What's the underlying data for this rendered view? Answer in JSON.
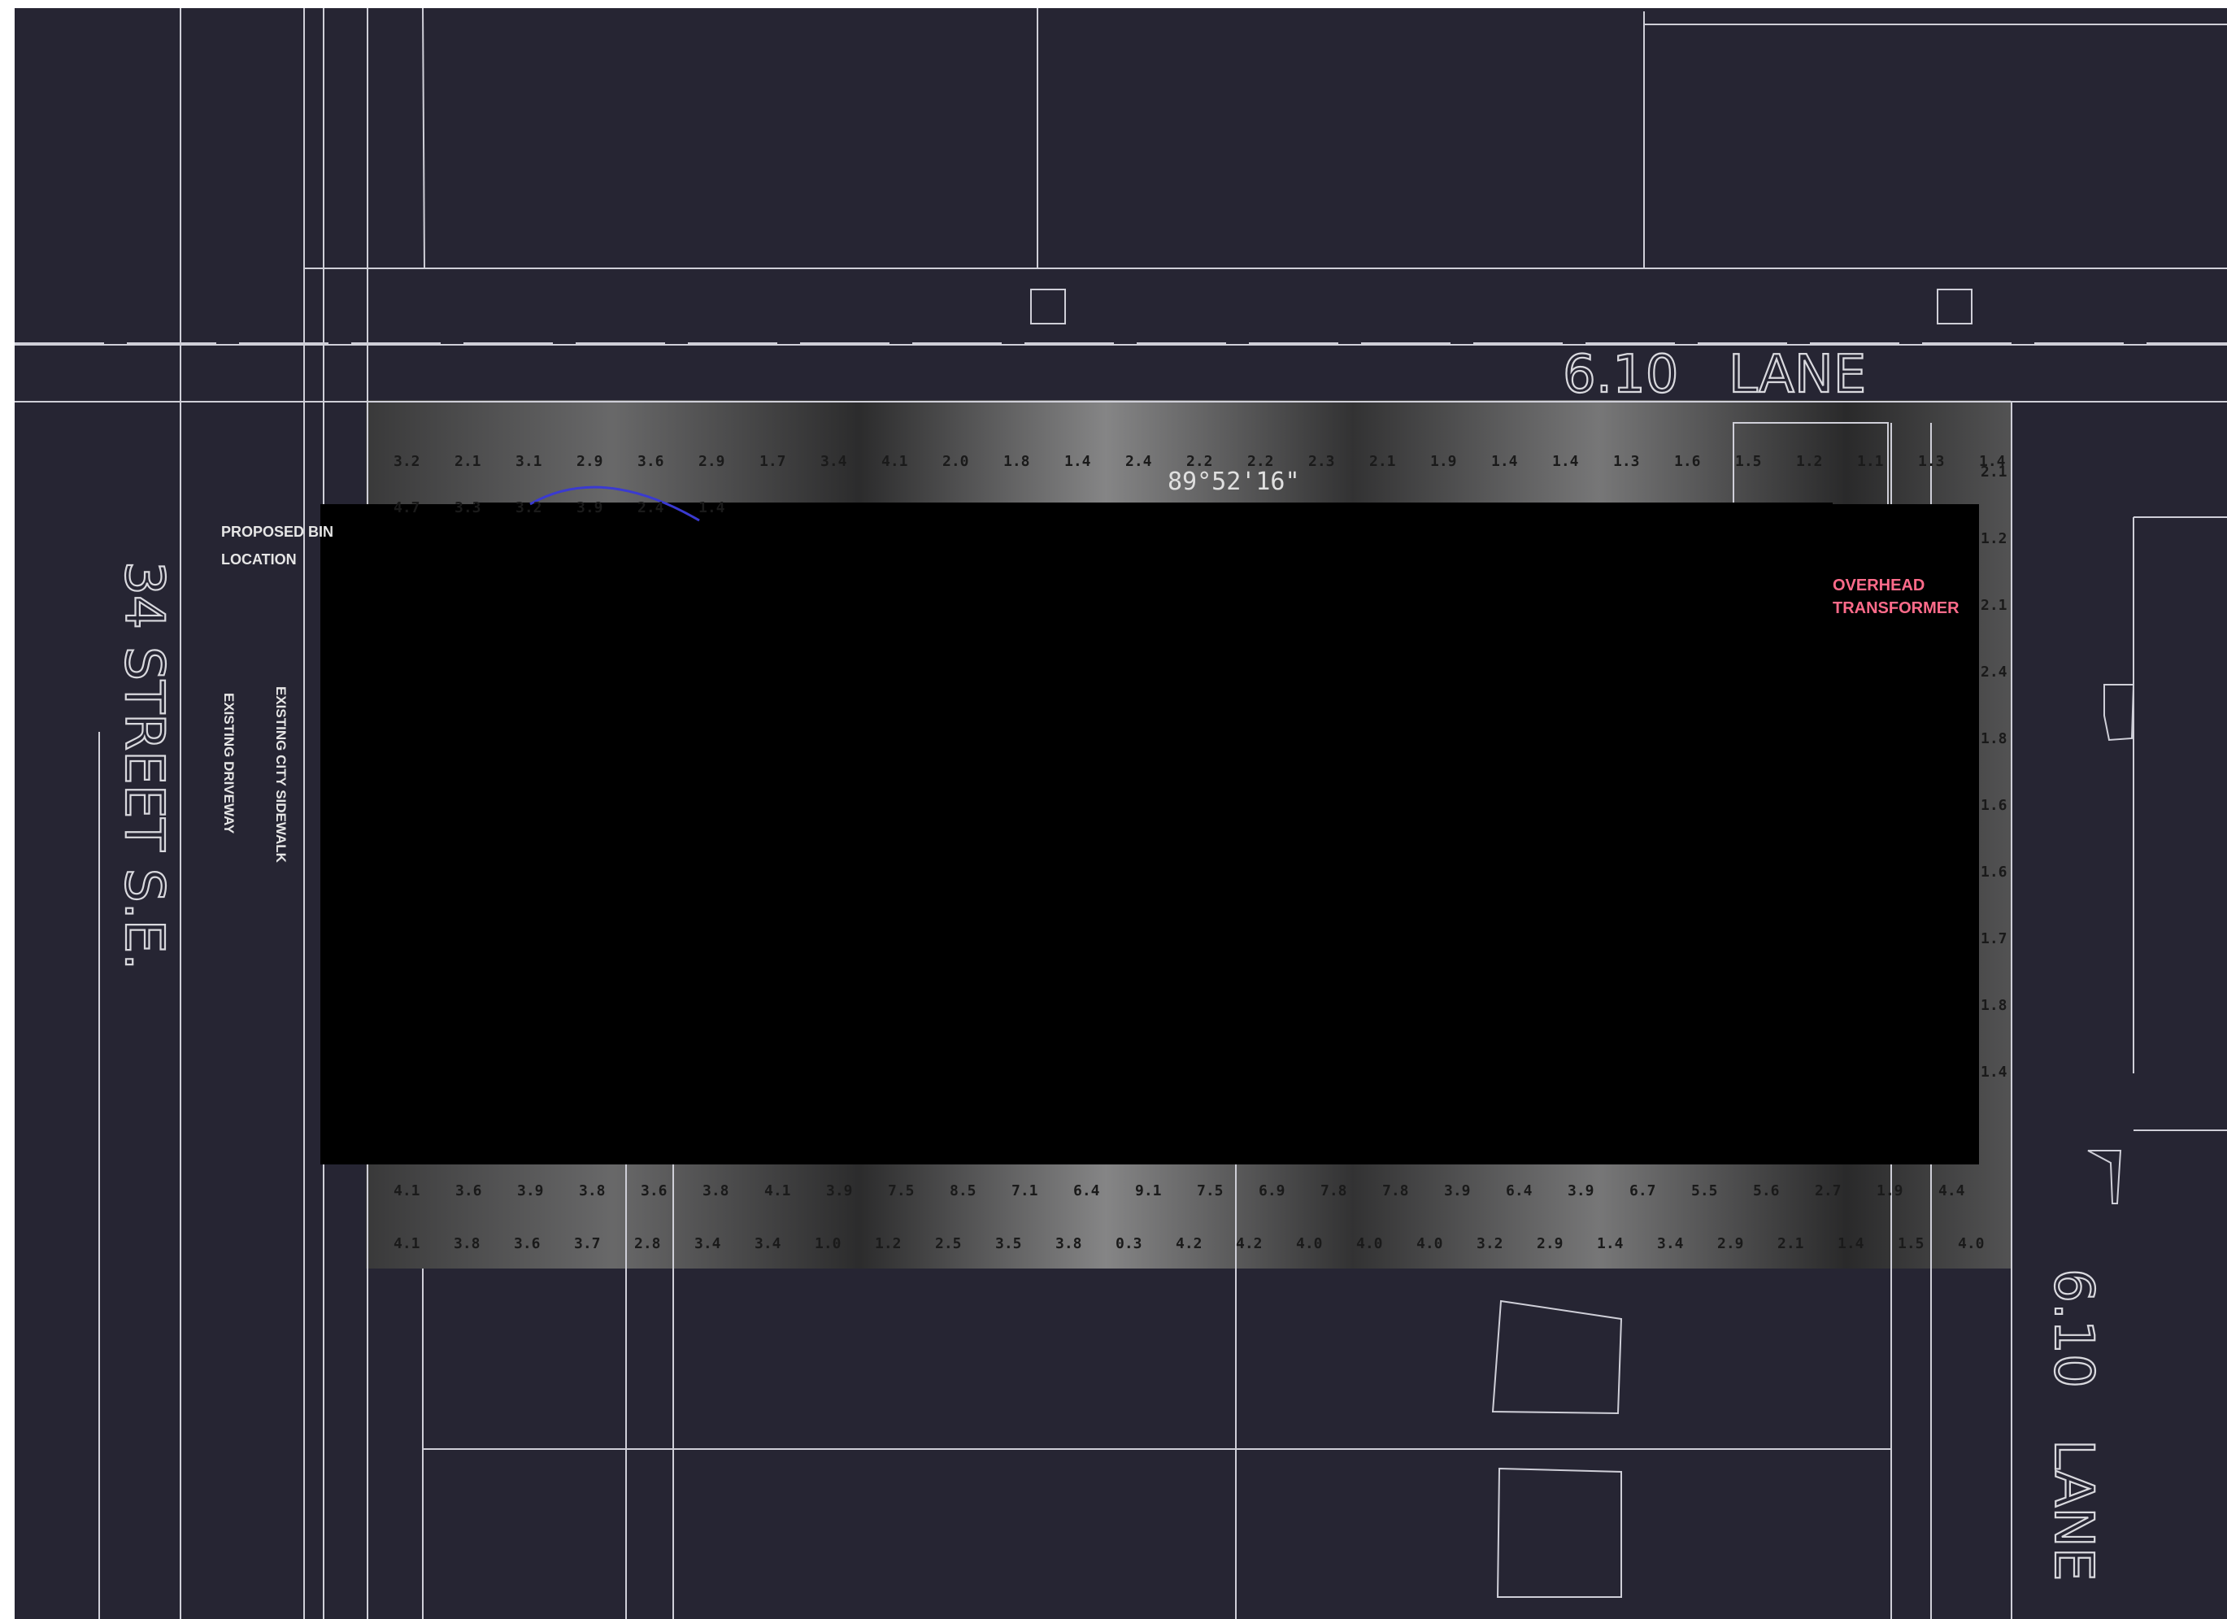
{
  "labels": {
    "lane_top_width": "6.10",
    "lane_top_name": "LANE",
    "lane_right_width": "6.10",
    "lane_right_name": "LANE",
    "street": "34  STREET  S.E.",
    "bearing": "89°52'16\"",
    "left_note_line1": "PROPOSED BIN",
    "left_note_line2": "LOCATION",
    "vertical_note_1": "EXISTING DRIVEWAY",
    "vertical_note_2": "EXISTING CITY SIDEWALK",
    "transformer_line1": "OVERHEAD",
    "transformer_line2": "TRANSFORMER"
  },
  "colors": {
    "background": "#262533",
    "linework": "#cfcfd8",
    "transformer_text": "#ff6b8a",
    "arc": "#3a3ad0",
    "redaction": "#000000"
  },
  "photometric_rows": {
    "top": [
      "3.2",
      "2.1",
      "3.1",
      "2.9",
      "3.6",
      "2.9",
      "1.7",
      "3.4",
      "4.1",
      "2.0",
      "1.8",
      "1.4",
      "2.4",
      "2.2",
      "2.2",
      "2.3",
      "2.1",
      "1.9",
      "1.4",
      "1.4",
      "1.3",
      "1.6",
      "1.5",
      "1.2",
      "1.1",
      "1.3",
      "1.4"
    ],
    "second_partial": [
      "4.7",
      "3.3",
      "3.2",
      "3.9",
      "2.4",
      "1.4"
    ],
    "bottom_1": [
      "4.1",
      "3.6",
      "3.9",
      "3.8",
      "3.6",
      "3.8",
      "4.1",
      "3.9",
      "7.5",
      "8.5",
      "7.1",
      "6.4",
      "9.1",
      "7.5",
      "6.9",
      "7.8",
      "7.8",
      "3.9",
      "6.4",
      "3.9",
      "6.7",
      "5.5",
      "5.6",
      "2.7",
      "1.9",
      "4.4"
    ],
    "bottom_2": [
      "4.1",
      "3.8",
      "3.6",
      "3.7",
      "2.8",
      "3.4",
      "3.4",
      "1.0",
      "1.2",
      "2.5",
      "3.5",
      "3.8",
      "0.3",
      "4.2",
      "4.2",
      "4.0",
      "4.0",
      "4.0",
      "3.2",
      "2.9",
      "1.4",
      "3.4",
      "2.9",
      "2.1",
      "1.4",
      "1.5",
      "4.0"
    ],
    "right_column": [
      "2.1",
      "1.2",
      "2.1",
      "2.4",
      "1.8",
      "1.6",
      "1.6",
      "1.7",
      "1.8",
      "1.4"
    ]
  }
}
